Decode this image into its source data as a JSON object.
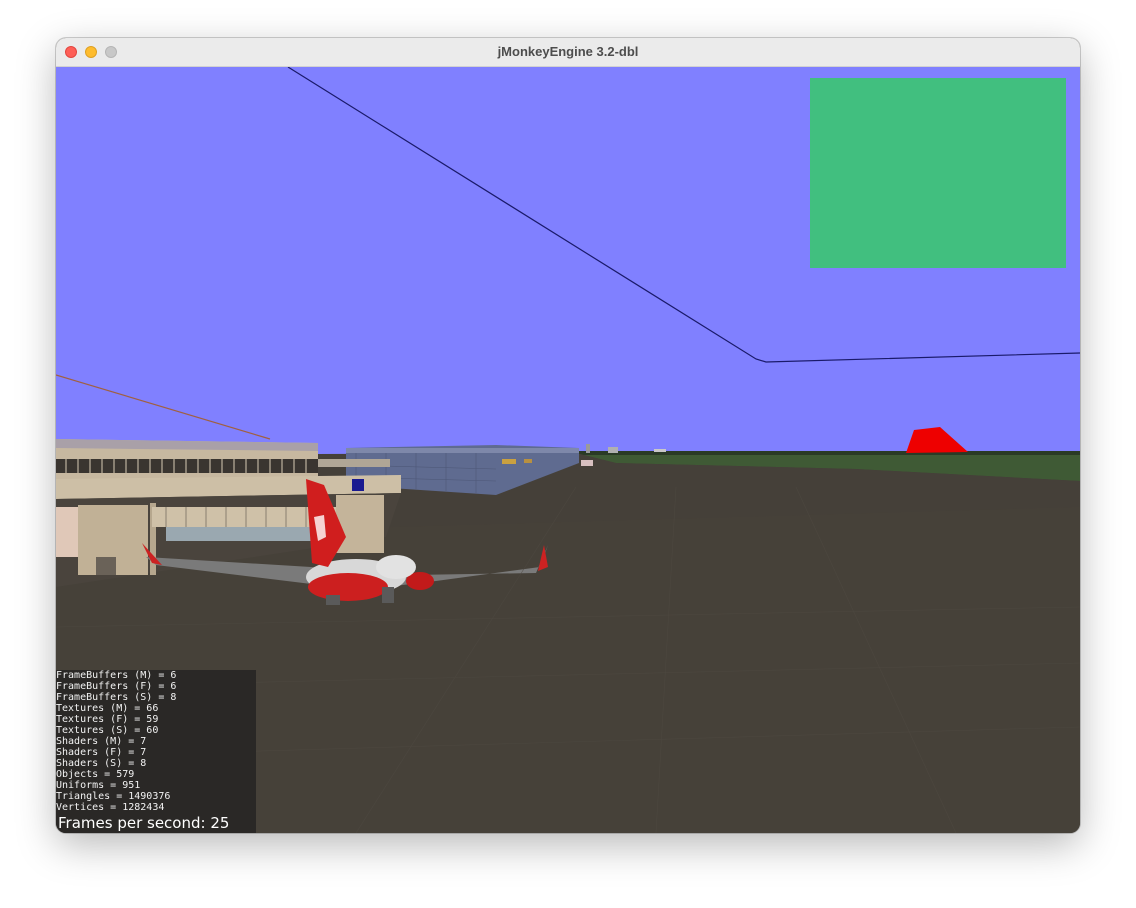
{
  "window": {
    "title": "jMonkeyEngine 3.2-dbl"
  },
  "scene": {
    "sky_color": "#8080ff",
    "ground_color": "#454039",
    "overlay_color": "#41bf7f",
    "marker_color": "#ee0000"
  },
  "stats": {
    "lines": [
      "FrameBuffers (M) = 6",
      "FrameBuffers (F) = 6",
      "FrameBuffers (S) = 8",
      "Textures (M) = 66",
      "Textures (F) = 59",
      "Textures (S) = 60",
      "Shaders (M) = 7",
      "Shaders (F) = 7",
      "Shaders (S) = 8",
      "Objects = 579",
      "Uniforms = 951",
      "Triangles = 1490376",
      "Vertices = 1282434"
    ],
    "fps_text": "Frames per second: 25"
  }
}
